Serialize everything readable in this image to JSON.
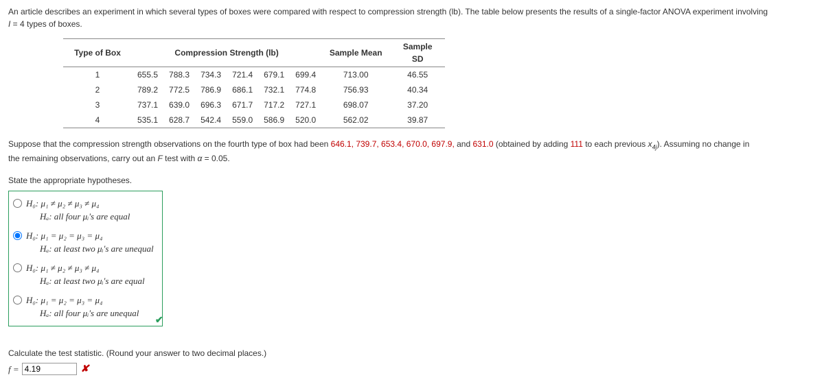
{
  "intro": {
    "line1": "An article describes an experiment in which several types of boxes were compared with respect to compression strength (lb). The table below presents the results of a single-factor ANOVA experiment involving",
    "line2_prefix": "I",
    "line2_rest": " = 4 types of boxes."
  },
  "table": {
    "headers": {
      "type": "Type of Box",
      "strength": "Compression Strength (lb)",
      "mean": "Sample Mean",
      "sd": "Sample SD"
    },
    "rows": [
      {
        "type": "1",
        "vals": [
          "655.5",
          "788.3",
          "734.3",
          "721.4",
          "679.1",
          "699.4"
        ],
        "mean": "713.00",
        "sd": "46.55"
      },
      {
        "type": "2",
        "vals": [
          "789.2",
          "772.5",
          "786.9",
          "686.1",
          "732.1",
          "774.8"
        ],
        "mean": "756.93",
        "sd": "40.34"
      },
      {
        "type": "3",
        "vals": [
          "737.1",
          "639.0",
          "696.3",
          "671.7",
          "717.2",
          "727.1"
        ],
        "mean": "698.07",
        "sd": "37.20"
      },
      {
        "type": "4",
        "vals": [
          "535.1",
          "628.7",
          "542.4",
          "559.0",
          "586.9",
          "520.0"
        ],
        "mean": "562.02",
        "sd": "39.87"
      }
    ]
  },
  "suppose": {
    "part1": "Suppose that the compression strength observations on the fourth type of box had been ",
    "red_vals": "646.1, 739.7, 653.4, 670.0, 697.9,",
    "part2": " and ",
    "red_last": "631.0",
    "part3": " (obtained by adding ",
    "red_add": "111",
    "part4": " to each previous ",
    "xvar": "x",
    "xsub": "4j",
    "part5": "). Assuming no change in",
    "line2": "the remaining observations, carry out an ",
    "Fvar": "F",
    "line2b": " test with ",
    "alpha": "α",
    "line2c": " = 0.05."
  },
  "state_label": "State the appropriate hypotheses.",
  "options": {
    "opt1": {
      "h0": "H₀: μ₁ ≠ μ₂ ≠ μ₃ ≠ μ₄",
      "ha": "Hₐ: all four μᵢ's are equal"
    },
    "opt2": {
      "h0": "H₀: μ₁ = μ₂ = μ₃ = μ₄",
      "ha": "Hₐ: at least two μᵢ's are unequal"
    },
    "opt3": {
      "h0": "H₀: μ₁ ≠ μ₂ ≠ μ₃ ≠ μ₄",
      "ha": "Hₐ: at least two μᵢ's are equal"
    },
    "opt4": {
      "h0": "H₀: μ₁ = μ₂ = μ₃ = μ₄",
      "ha": "Hₐ: all four μᵢ's are unequal"
    }
  },
  "calc": {
    "prompt": "Calculate the test statistic. (Round your answer to two decimal places.)",
    "f_label": "f = ",
    "f_value": "4.19"
  },
  "icons": {
    "check": "✔",
    "cross": "✘"
  }
}
